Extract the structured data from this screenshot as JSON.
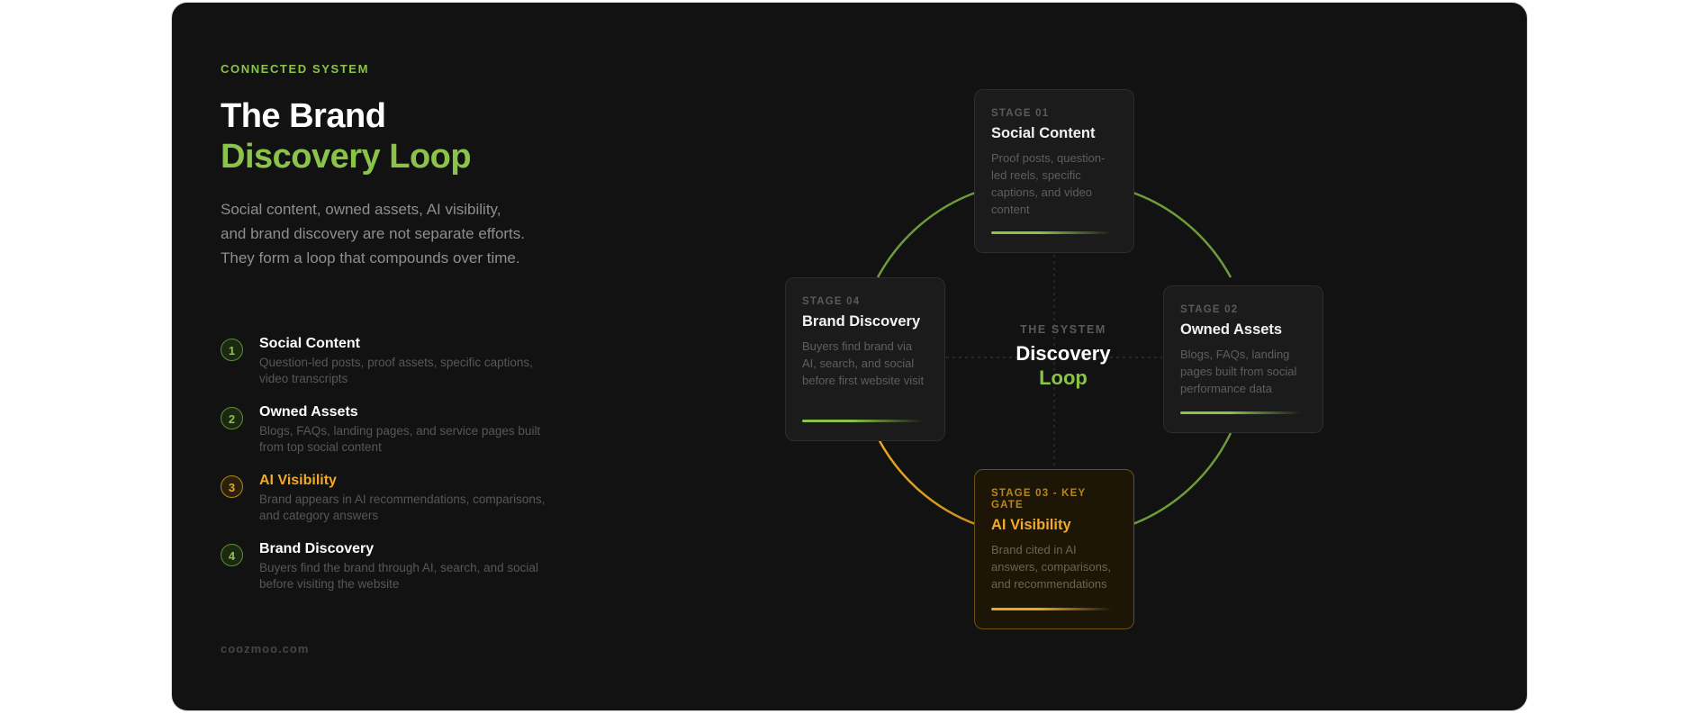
{
  "header": {
    "eyebrow": "CONNECTED SYSTEM",
    "title_line1": "The Brand",
    "title_line2": "Discovery Loop",
    "intro": "Social content, owned assets, AI visibility, and brand discovery are not separate efforts. They form a loop that compounds over time."
  },
  "steps": [
    {
      "num": "1",
      "title": "Social Content",
      "desc": "Question-led posts, proof assets, specific captions, video transcripts"
    },
    {
      "num": "2",
      "title": "Owned Assets",
      "desc": "Blogs, FAQs, landing pages, and service pages built from top social content"
    },
    {
      "num": "3",
      "title": "AI Visibility",
      "desc": "Brand appears in AI recommendations, comparisons, and category answers"
    },
    {
      "num": "4",
      "title": "Brand Discovery",
      "desc": "Buyers find the brand through AI, search, and social before visiting the website"
    }
  ],
  "footer": "coozmoo.com",
  "diagram": {
    "center_eyebrow": "THE SYSTEM",
    "center_line1": "Discovery",
    "center_line2": "Loop",
    "stages": [
      {
        "label": "STAGE 01",
        "name": "Social Content",
        "desc": "Proof posts, question-led reels, specific captions, and video content"
      },
      {
        "label": "STAGE 02",
        "name": "Owned Assets",
        "desc": "Blogs, FAQs, landing pages built from social performance data"
      },
      {
        "label": "STAGE 03 - KEY GATE",
        "name": "AI Visibility",
        "desc": "Brand cited in AI answers, comparisons, and recommendations"
      },
      {
        "label": "STAGE 04",
        "name": "Brand Discovery",
        "desc": "Buyers find brand via AI, search, and social before first website visit"
      }
    ]
  },
  "colors": {
    "green": "#8bc34a",
    "gold": "#e8a822",
    "background": "#121212"
  }
}
